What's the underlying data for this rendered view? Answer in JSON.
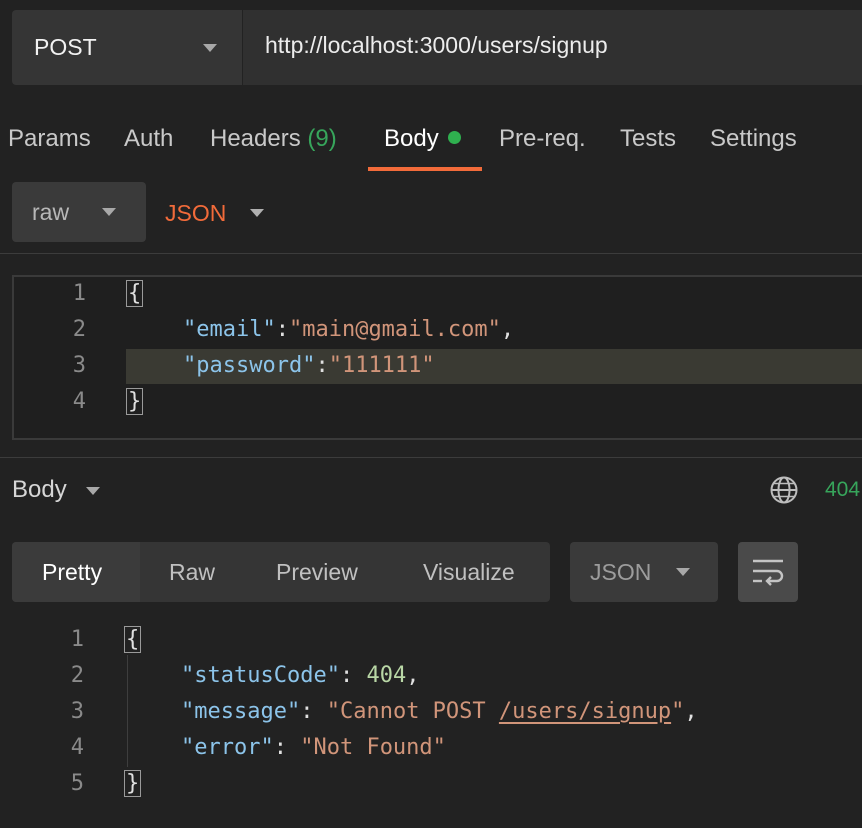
{
  "request": {
    "method": "POST",
    "url": "http://localhost:3000/users/signup"
  },
  "tabs": [
    {
      "label": "Params"
    },
    {
      "label": "Auth"
    },
    {
      "label": "Headers",
      "count": "(9)"
    },
    {
      "label": "Body",
      "active": true
    },
    {
      "label": "Pre-req."
    },
    {
      "label": "Tests"
    },
    {
      "label": "Settings"
    }
  ],
  "body_type": {
    "mode": "raw",
    "language": "JSON"
  },
  "request_body": {
    "line_numbers": [
      "1",
      "2",
      "3",
      "4"
    ],
    "open": "{",
    "close": "}",
    "email_key": "\"email\"",
    "email_value": "\"main@gmail.com\"",
    "password_key": "\"password\"",
    "password_value": "\"111111\""
  },
  "response": {
    "section_label": "Body",
    "status": "404",
    "view_tabs": [
      "Pretty",
      "Raw",
      "Preview",
      "Visualize"
    ],
    "format": "JSON",
    "line_numbers": [
      "1",
      "2",
      "3",
      "4",
      "5"
    ],
    "open": "{",
    "close": "}",
    "status_key": "\"statusCode\"",
    "status_value": "404",
    "message_key": "\"message\"",
    "message_value_start": "\"Cannot POST ",
    "message_value_link": "/users/signup",
    "message_value_end": "\"",
    "error_key": "\"error\"",
    "error_value": "\"Not Found\""
  },
  "colors": {
    "accent": "#f26b3a",
    "success": "#37a55b",
    "json_key": "#8cc4ea",
    "json_string": "#d1957a",
    "json_number": "#b9d7a6"
  },
  "icons": {
    "globe": "globe-icon",
    "wrap": "wrap-lines-icon"
  }
}
